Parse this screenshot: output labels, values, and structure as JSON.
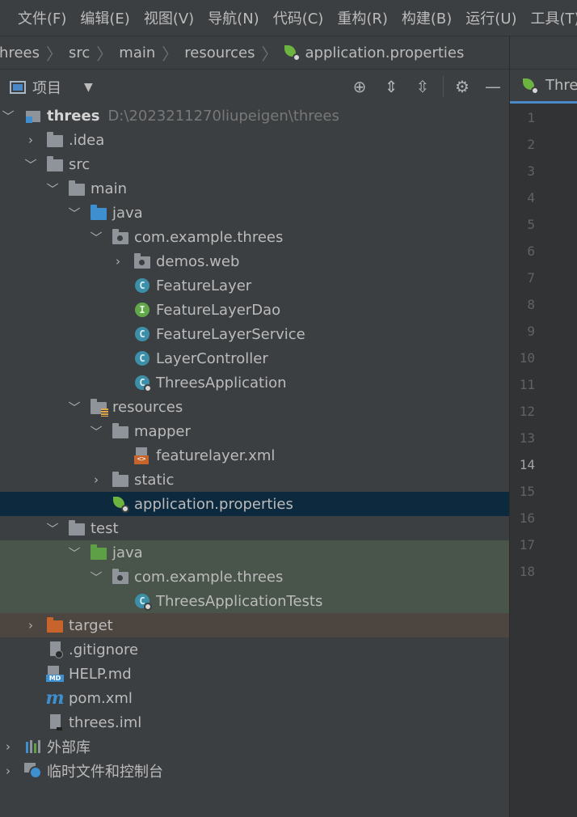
{
  "menu": [
    "文件(F)",
    "编辑(E)",
    "视图(V)",
    "导航(N)",
    "代码(C)",
    "重构(R)",
    "构建(B)",
    "运行(U)",
    "工具(T)"
  ],
  "breadcrumb": [
    "threes",
    "src",
    "main",
    "resources",
    "application.properties"
  ],
  "project_panel": {
    "title": "项目"
  },
  "tree": {
    "root": {
      "name": "threes",
      "path": "D:\\2023211270liupeigen\\threes"
    },
    "idea": ".idea",
    "src": "src",
    "main": "main",
    "java": "java",
    "pkg": "com.example.threes",
    "demos": "demos.web",
    "featurelayer": "FeatureLayer",
    "featurelayerdao": "FeatureLayerDao",
    "featurelayerservice": "FeatureLayerService",
    "layercontroller": "LayerController",
    "threesapp": "ThreesApplication",
    "resources": "resources",
    "mapper": "mapper",
    "featurelayer_xml": "featurelayer.xml",
    "static": "static",
    "app_props": "application.properties",
    "test": "test",
    "test_java": "java",
    "test_pkg": "com.example.threes",
    "threesapptests": "ThreesApplicationTests",
    "target": "target",
    "gitignore": ".gitignore",
    "help": "HELP.md",
    "pom": "pom.xml",
    "iml": "threes.iml",
    "external": "外部库",
    "scratches": "临时文件和控制台"
  },
  "editor": {
    "tab_label": "ThreesApplication",
    "line_numbers": [
      "1",
      "2",
      "3",
      "4",
      "5",
      "6",
      "7",
      "8",
      "9",
      "10",
      "11",
      "12",
      "13",
      "14",
      "15",
      "16",
      "17",
      "18"
    ],
    "current_line": 14
  },
  "colors": {
    "selected_row": "#0d293e",
    "test_rows": "#49544a",
    "excluded_row": "#4d4540",
    "source_folder": "#3d8fcf",
    "test_folder": "#5ea046",
    "class_icon": "#3d8fa8",
    "interface_icon": "#62a84b"
  }
}
